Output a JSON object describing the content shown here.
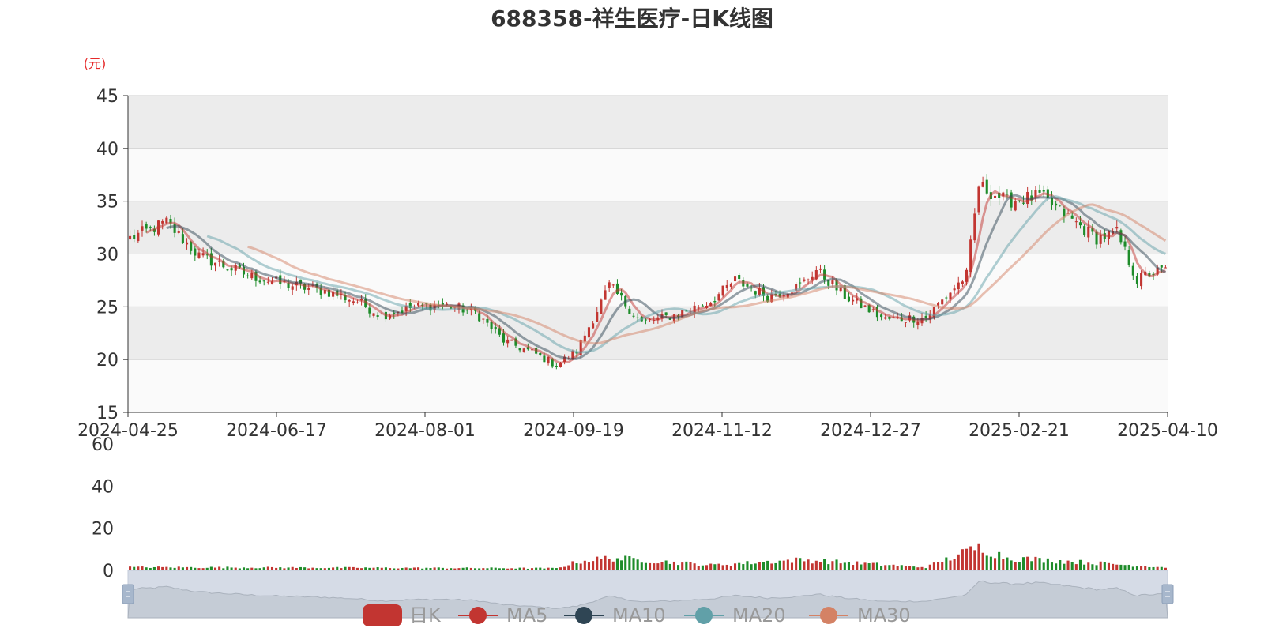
{
  "chart_data": {
    "type": "candlestick",
    "title": "688358-祥生医疗-日K线图",
    "y_unit": "(元)",
    "ylim": [
      15,
      45
    ],
    "y_ticks": [
      15,
      20,
      25,
      30,
      35,
      40,
      45
    ],
    "x_tick_labels": [
      "2024-04-25",
      "2024-06-17",
      "2024-08-01",
      "2024-09-19",
      "2024-11-12",
      "2024-12-27",
      "2025-02-21",
      "2025-04-10"
    ],
    "volume_ylim": [
      0,
      60
    ],
    "volume_ticks": [
      0,
      20,
      40,
      60
    ],
    "colors": {
      "up": "#c23531",
      "down": "#1e8c2a",
      "ma5": "#c23531",
      "ma10": "#2f4554",
      "ma20": "#61a0a8",
      "ma30": "#d48265"
    },
    "price_knots": [
      {
        "date": "2024-04-25",
        "close": 31.5
      },
      {
        "date": "2024-05-08",
        "close": 33.0
      },
      {
        "date": "2024-05-20",
        "close": 29.8
      },
      {
        "date": "2024-06-05",
        "close": 28.0
      },
      {
        "date": "2024-06-17",
        "close": 27.2
      },
      {
        "date": "2024-07-02",
        "close": 26.5
      },
      {
        "date": "2024-07-12",
        "close": 25.5
      },
      {
        "date": "2024-07-22",
        "close": 24.2
      },
      {
        "date": "2024-08-01",
        "close": 25.0
      },
      {
        "date": "2024-08-12",
        "close": 25.2
      },
      {
        "date": "2024-08-22",
        "close": 24.5
      },
      {
        "date": "2024-09-02",
        "close": 21.8
      },
      {
        "date": "2024-09-12",
        "close": 20.5
      },
      {
        "date": "2024-09-19",
        "close": 19.5
      },
      {
        "date": "2024-09-26",
        "close": 20.8
      },
      {
        "date": "2024-10-08",
        "close": 27.0
      },
      {
        "date": "2024-10-18",
        "close": 23.5
      },
      {
        "date": "2024-10-30",
        "close": 24.2
      },
      {
        "date": "2024-11-12",
        "close": 25.5
      },
      {
        "date": "2024-11-20",
        "close": 27.5
      },
      {
        "date": "2024-12-02",
        "close": 26.0
      },
      {
        "date": "2024-12-12",
        "close": 27.0
      },
      {
        "date": "2024-12-18",
        "close": 28.5
      },
      {
        "date": "2024-12-27",
        "close": 26.0
      },
      {
        "date": "2025-01-10",
        "close": 23.8
      },
      {
        "date": "2025-01-24",
        "close": 24.0
      },
      {
        "date": "2025-02-07",
        "close": 28.0
      },
      {
        "date": "2025-02-12",
        "close": 36.5
      },
      {
        "date": "2025-02-21",
        "close": 35.0
      },
      {
        "date": "2025-03-05",
        "close": 35.5
      },
      {
        "date": "2025-03-14",
        "close": 33.5
      },
      {
        "date": "2025-03-25",
        "close": 31.5
      },
      {
        "date": "2025-04-01",
        "close": 32.0
      },
      {
        "date": "2025-04-08",
        "close": 27.5
      },
      {
        "date": "2025-04-10",
        "close": 28.0
      },
      {
        "date": "2025-04-17",
        "close": 28.5
      }
    ],
    "volume_knots": [
      {
        "date": "2024-04-25",
        "volume": 1.5
      },
      {
        "date": "2024-09-19",
        "volume": 1.0
      },
      {
        "date": "2024-09-26",
        "volume": 4.0
      },
      {
        "date": "2024-10-08",
        "volume": 6.0
      },
      {
        "date": "2024-11-12",
        "volume": 2.5
      },
      {
        "date": "2024-12-12",
        "volume": 5.0
      },
      {
        "date": "2025-01-24",
        "volume": 1.5
      },
      {
        "date": "2025-02-12",
        "volume": 11.0
      },
      {
        "date": "2025-02-21",
        "volume": 6.0
      },
      {
        "date": "2025-04-17",
        "volume": 1.5
      }
    ],
    "legend": [
      "日K",
      "MA5",
      "MA10",
      "MA20",
      "MA30"
    ]
  },
  "datazoom_handles": [
    "left-handle",
    "right-handle"
  ]
}
